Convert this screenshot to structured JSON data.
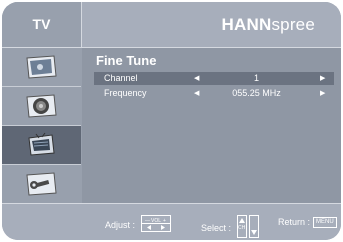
{
  "header": {
    "section_label": "TV",
    "brand_bold": "HANN",
    "brand_light": "spree"
  },
  "sidebar": {
    "items": [
      {
        "icon": "picture-icon",
        "active": false
      },
      {
        "icon": "audio-icon",
        "active": false
      },
      {
        "icon": "tv-icon",
        "active": true
      },
      {
        "icon": "tools-icon",
        "active": false
      }
    ]
  },
  "menu": {
    "title": "Fine Tune",
    "rows": [
      {
        "label": "Channel",
        "value": "1",
        "selected": true
      },
      {
        "label": "Frequency",
        "value": "055.25 MHz",
        "selected": false
      }
    ]
  },
  "footer": {
    "adjust_label": "Adjust :",
    "vol_key": "VOL",
    "select_label": "Select :",
    "ch_key": "CH",
    "return_label": "Return :",
    "menu_key": "MENU"
  }
}
